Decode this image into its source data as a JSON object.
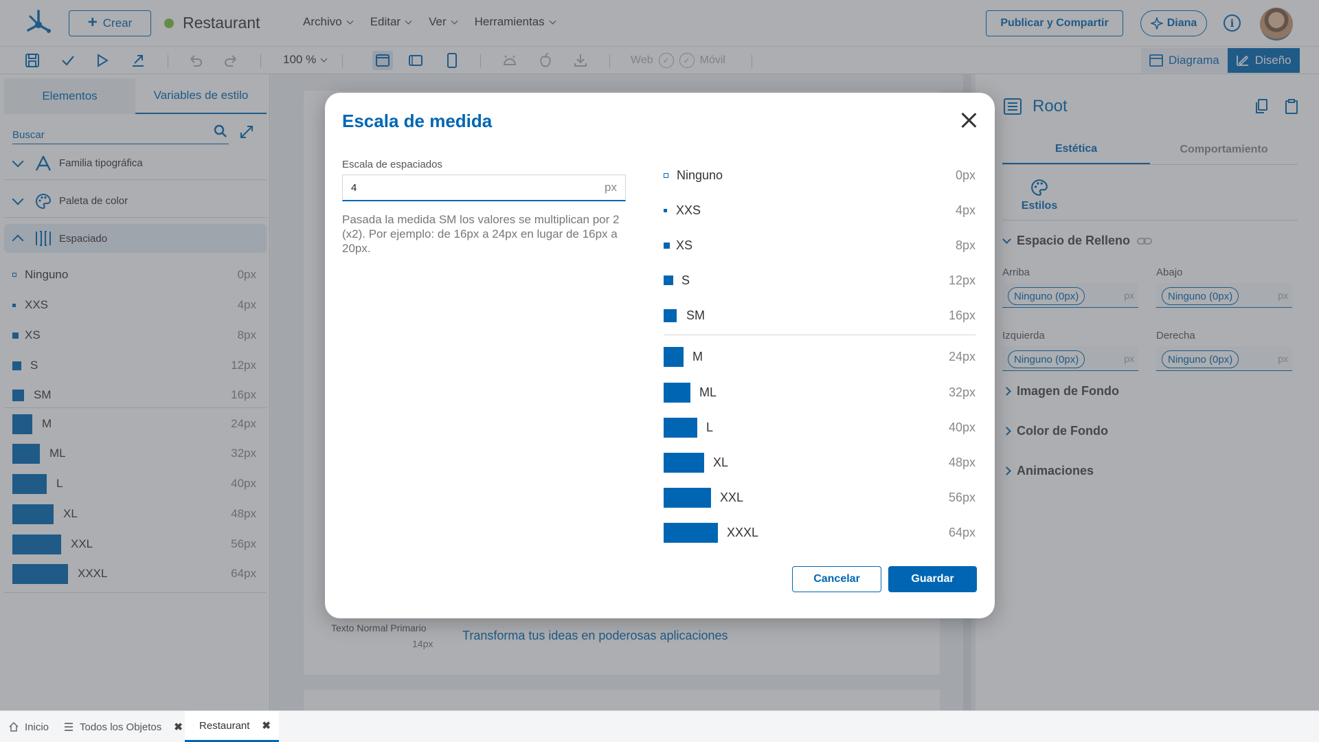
{
  "colors": {
    "accent": "#0066b3",
    "status_dot": "#7ac143"
  },
  "header": {
    "create_label": "Crear",
    "app_name": "Restaurant",
    "menu": [
      {
        "label": "Archivo"
      },
      {
        "label": "Editar"
      },
      {
        "label": "Ver"
      },
      {
        "label": "Herramientas"
      }
    ],
    "publish_label": "Publicar y Compartir",
    "assistant_label": "Diana"
  },
  "toolbar": {
    "zoom": "100 %",
    "web_label": "Web",
    "movil_label": "Móvil",
    "diagram_label": "Diagrama",
    "design_label": "Diseño"
  },
  "left": {
    "tabs": [
      "Elementos",
      "Variables de estilo"
    ],
    "search_placeholder": "Buscar",
    "sections": [
      {
        "label": "Familia tipográfica",
        "icon": "font-icon"
      },
      {
        "label": "Paleta de color",
        "icon": "palette-icon"
      },
      {
        "label": "Espaciado",
        "icon": "spacing-icon"
      }
    ],
    "spacing": [
      {
        "name": "Ninguno",
        "value": "0px"
      },
      {
        "name": "XXS",
        "value": "4px"
      },
      {
        "name": "XS",
        "value": "8px"
      },
      {
        "name": "S",
        "value": "12px"
      },
      {
        "name": "SM",
        "value": "16px"
      },
      {
        "name": "M",
        "value": "24px"
      },
      {
        "name": "ML",
        "value": "32px"
      },
      {
        "name": "L",
        "value": "40px"
      },
      {
        "name": "XL",
        "value": "48px"
      },
      {
        "name": "XXL",
        "value": "56px"
      },
      {
        "name": "XXXL",
        "value": "64px"
      }
    ]
  },
  "canvas": {
    "text_style_label": "Texto Normal Primario",
    "text_style_size": "14px",
    "sample_text": "Transforma tus ideas en poderosas aplicaciones"
  },
  "right": {
    "title": "Root",
    "tabs": [
      "Estética",
      "Comportamiento"
    ],
    "styles_label": "Estilos",
    "padding_section": "Espacio de Relleno",
    "fields": [
      {
        "label": "Arriba",
        "value": "Ninguno (0px)",
        "unit": "px"
      },
      {
        "label": "Abajo",
        "value": "Ninguno (0px)",
        "unit": "px"
      },
      {
        "label": "Izquierda",
        "value": "Ninguno (0px)",
        "unit": "px"
      },
      {
        "label": "Derecha",
        "value": "Ninguno (0px)",
        "unit": "px"
      }
    ],
    "sections": [
      "Imagen de Fondo",
      "Color de Fondo",
      "Animaciones"
    ]
  },
  "modal": {
    "title": "Escala de medida",
    "input_label": "Escala de espaciados",
    "input_value": "4",
    "input_unit": "px",
    "help": "Pasada la medida SM los valores se multiplican por 2 (x2). Por ejemplo: de 16px a 24px en lugar de 16px a 20px.",
    "cancel_label": "Cancelar",
    "save_label": "Guardar"
  },
  "bottom_tabs": [
    {
      "label": "Inicio",
      "icon": "home-icon"
    },
    {
      "label": "Todos los Objetos",
      "icon": "list-icon"
    },
    {
      "label": "Restaurant",
      "icon": "folder-icon"
    }
  ]
}
